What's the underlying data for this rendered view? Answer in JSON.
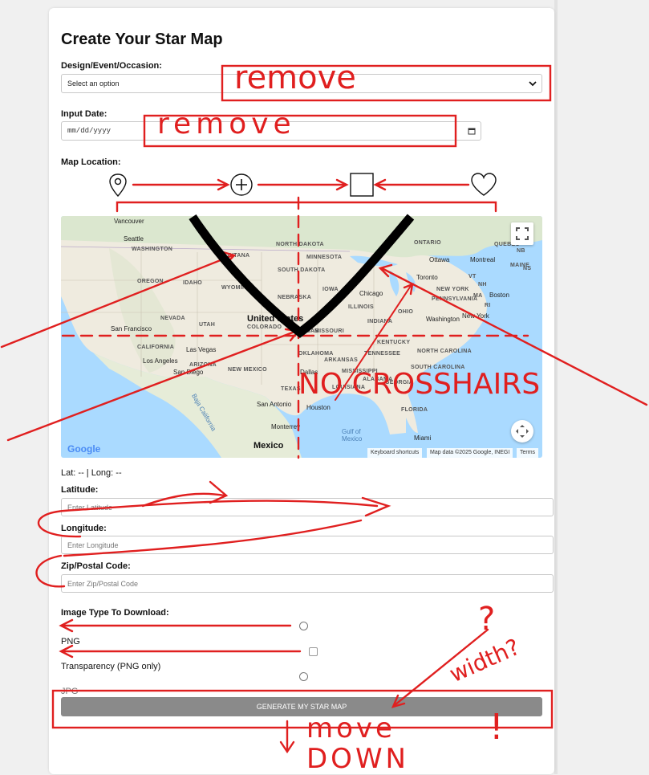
{
  "form": {
    "title": "Create Your Star Map",
    "design_label": "Design/Event/Occasion:",
    "design_value": "Select an option",
    "date_label": "Input Date:",
    "date_placeholder": "mm/dd/yyyy",
    "location_label": "Map Location:",
    "lat_long_readout": "Lat: -- | Long: --",
    "latitude_label": "Latitude:",
    "latitude_placeholder": "Enter Latitude",
    "longitude_label": "Longitude:",
    "longitude_placeholder": "Enter Longitude",
    "zip_label": "Zip/Postal Code:",
    "zip_placeholder": "Enter Zip/Postal Code",
    "image_type_label": "Image Type To Download:",
    "png_label": "PNG",
    "transparency_label": "Transparency (PNG only)",
    "jpg_label": "JPG",
    "generate_label": "GENERATE MY STAR MAP"
  },
  "shapes": [
    "pin-icon",
    "plus-circle-icon",
    "square-icon",
    "heart-icon"
  ],
  "map": {
    "region_labels": [
      "WASHINGTON",
      "OREGON",
      "IDAHO",
      "MONTANA",
      "NORTH DAKOTA",
      "SOUTH DAKOTA",
      "WYOMING",
      "NEBRASKA",
      "NEVADA",
      "UTAH",
      "COLORADO",
      "KANSAS",
      "CALIFORNIA",
      "ARIZONA",
      "NEW MEXICO",
      "OKLAHOMA",
      "TEXAS",
      "MINNESOTA",
      "IOWA",
      "ILLINOIS",
      "MISSOURI",
      "ARKANSAS",
      "MISSISSIPPI",
      "KENTUCKY",
      "TENNESSEE",
      "INDIANA",
      "OHIO",
      "PENNSYLVANIA",
      "NEW YORK",
      "NORTH CAROLINA",
      "SOUTH CAROLINA",
      "GEORGIA",
      "ALABAMA",
      "LOUISIANA",
      "FLORIDA",
      "MAINE",
      "NH",
      "VT",
      "MA",
      "RI",
      "ONTARIO",
      "QUEBEC",
      "NB",
      "NS"
    ],
    "cities": [
      "Vancouver",
      "Seattle",
      "Ottawa",
      "Montreal",
      "Toronto",
      "Chicago",
      "New York",
      "Boston",
      "Washington",
      "San Francisco",
      "Las Vegas",
      "Los Angeles",
      "San Diego",
      "Dallas",
      "San Antonio",
      "Houston",
      "Monterrey",
      "Miami"
    ],
    "country_main": "United States",
    "country_mexico": "Mexico",
    "gulf": "Gulf of Mexico",
    "baja": "Baja California",
    "google": "Google",
    "keyboard": "Keyboard shortcuts",
    "map_data": "Map data ©2025 Google, INEGI",
    "terms": "Terms"
  },
  "annotations": {
    "remove_1": "remove",
    "remove_2": "remove",
    "no_crosshairs": "NO CROSSHAIRS",
    "width": "width?",
    "question": "?",
    "move_down": "move DOWN",
    "exclaim": "!",
    "color": "#e01f1f"
  }
}
